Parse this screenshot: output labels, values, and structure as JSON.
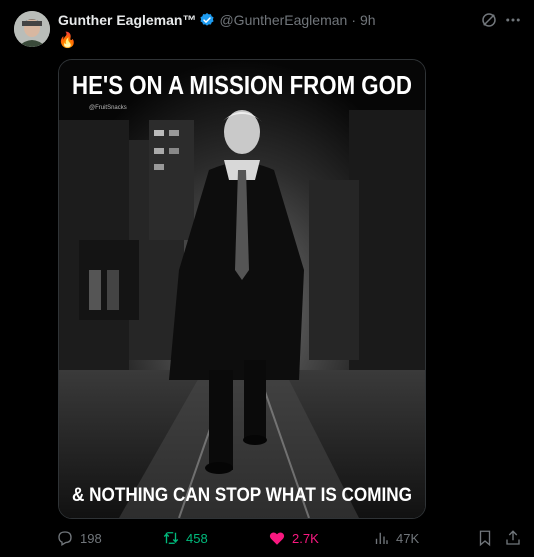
{
  "author": {
    "display_name": "Gunther Eagleman™",
    "handle": "@GuntherEagleman",
    "time": "9h",
    "verified_icon": "verified-badge-icon"
  },
  "tweet": {
    "text": "🔥"
  },
  "media": {
    "headline_top": "HE'S ON A MISSION FROM GOD",
    "watermark": "@FruitSnacks",
    "headline_bottom": "& NOTHING CAN STOP WHAT IS COMING"
  },
  "actions": {
    "replies": "198",
    "reposts": "458",
    "likes": "2.7K",
    "views": "47K"
  },
  "colors": {
    "background": "#000000",
    "text": "#e7e9ea",
    "muted": "#71767b",
    "verified": "#1d9bf0",
    "repost_active": "#00ba7c",
    "like_active": "#f91880"
  }
}
